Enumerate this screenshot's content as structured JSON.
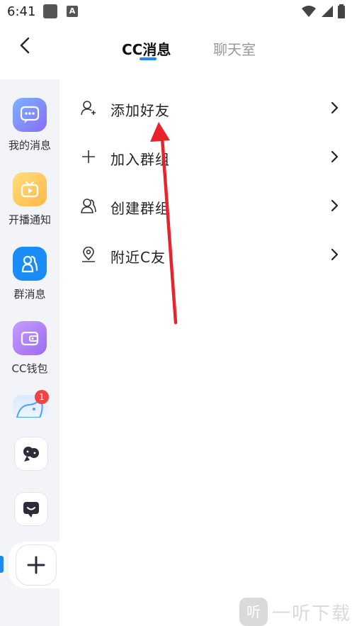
{
  "status_bar": {
    "time": "6:41",
    "a_icon_letter": "A"
  },
  "header": {
    "tab_active": "CC消息",
    "tab_inactive": "聊天室"
  },
  "sidebar": {
    "items": [
      {
        "label": "我的消息"
      },
      {
        "label": "开播通知"
      },
      {
        "label": "群消息"
      },
      {
        "label": "CC钱包"
      }
    ],
    "badge_count": "1"
  },
  "menu": {
    "items": [
      {
        "label": "添加好友"
      },
      {
        "label": "加入群组"
      },
      {
        "label": "创建群组"
      },
      {
        "label": "附近C友"
      }
    ]
  },
  "watermark": {
    "logo": "听",
    "text": "一听下载"
  },
  "colors": {
    "accent": "#1e88f0",
    "badge": "#f04343",
    "arrow": "#e8232b"
  }
}
